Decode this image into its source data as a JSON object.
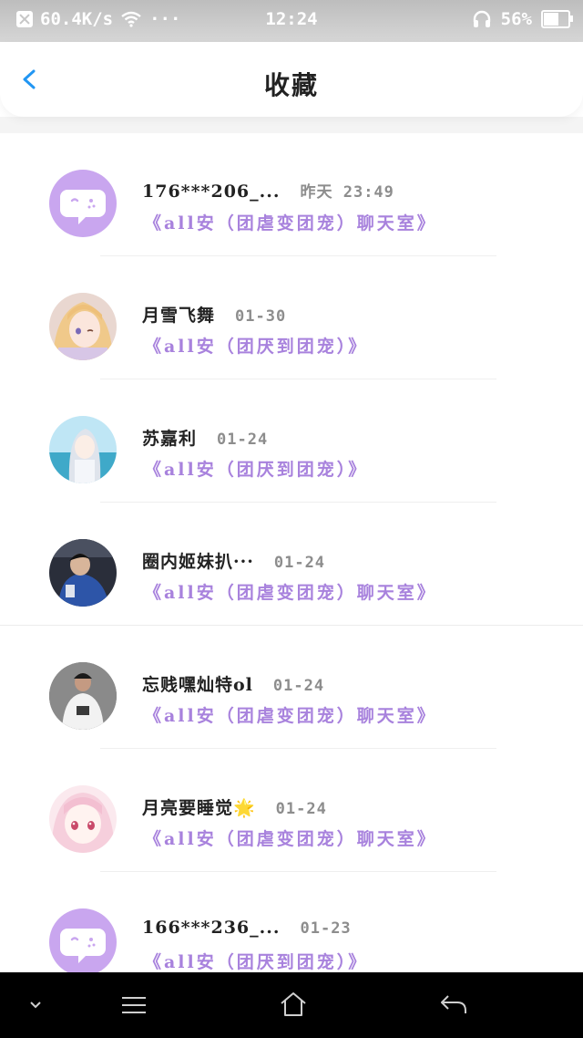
{
  "status_bar": {
    "net_speed": "60.4K/s",
    "dots": "···",
    "time": "12:24",
    "battery": "56%",
    "battery_level": 0.56
  },
  "header": {
    "title": "收藏"
  },
  "colors": {
    "accent": "#2196f3",
    "room_text": "#a882dd",
    "bubble": "#c9a6ef"
  },
  "items": [
    {
      "name": "176***206_...",
      "time": "昨天  23:49",
      "room": "《all安（团虐变团宠）聊天室》",
      "avatar": "chat-bubble-icon"
    },
    {
      "name": "月雪飞舞",
      "time": "01-30",
      "room": "《all安（团厌到团宠）》",
      "avatar": "anime-girl-blonde"
    },
    {
      "name": "苏嘉利",
      "time": "01-24",
      "room": "《all安（团厌到团宠）》",
      "avatar": "anime-girl-silver"
    },
    {
      "name": "圈内姬妹扒···",
      "time": "01-24",
      "room": "《all安（团虐变团宠）聊天室》",
      "avatar": "photo-person-dark"
    },
    {
      "name": "忘贱嘿灿特ol",
      "time": "01-24",
      "room": "《all安（团虐变团宠）聊天室》",
      "avatar": "photo-person-white-shirt"
    },
    {
      "name": "月亮要睡觉🌟",
      "time": "01-24",
      "room": "《all安（团虐变团宠）聊天室》",
      "avatar": "anime-girl-pink"
    },
    {
      "name": "166***236_...",
      "time": "01-23",
      "room": "《all安（团厌到团宠）》",
      "avatar": "chat-bubble-icon"
    }
  ]
}
